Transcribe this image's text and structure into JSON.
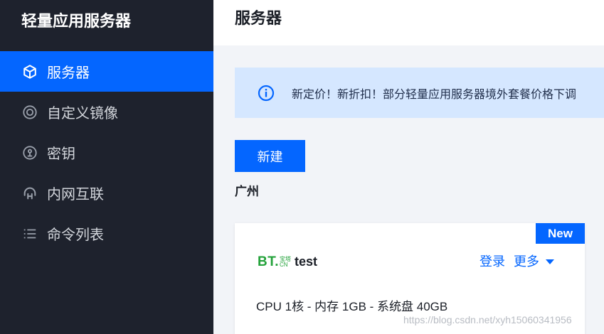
{
  "sidebar": {
    "brand": "轻量应用服务器",
    "items": [
      {
        "label": "服务器",
        "icon": "cube-icon",
        "active": true
      },
      {
        "label": "自定义镜像",
        "icon": "disc-icon",
        "active": false
      },
      {
        "label": "密钥",
        "icon": "key-icon",
        "active": false
      },
      {
        "label": "内网互联",
        "icon": "network-icon",
        "active": false
      },
      {
        "label": "命令列表",
        "icon": "list-icon",
        "active": false
      }
    ]
  },
  "header": {
    "title": "服务器"
  },
  "notice": {
    "text": "新定价！新折扣！部分轻量应用服务器境外套餐价格下调",
    "icon": "info-icon"
  },
  "actions": {
    "create_label": "新建"
  },
  "region": {
    "name": "广州"
  },
  "server_card": {
    "badge": "New",
    "logo_main": "BT.",
    "logo_top": "宝塔",
    "logo_bottom": "CN",
    "name": "test",
    "login_label": "登录",
    "more_label": "更多",
    "specs": "CPU 1核 - 内存 1GB - 系统盘 40GB"
  },
  "watermark": "https://blog.csdn.net/xyh15060341956",
  "colors": {
    "sidebar_bg": "#1e222d",
    "accent": "#0466ff",
    "notice_bg": "#d5e7ff",
    "logo_green": "#23a23a"
  }
}
